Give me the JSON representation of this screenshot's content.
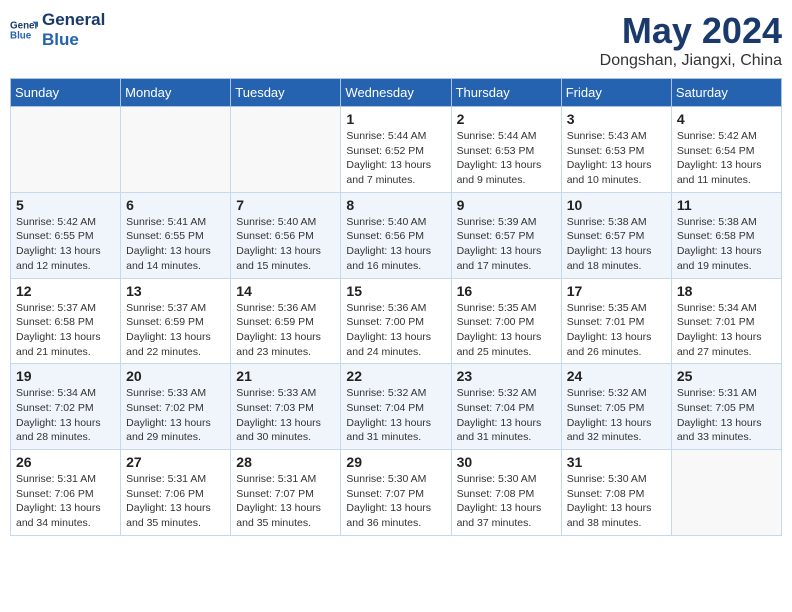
{
  "header": {
    "logo_line1": "General",
    "logo_line2": "Blue",
    "month_year": "May 2024",
    "location": "Dongshan, Jiangxi, China"
  },
  "weekdays": [
    "Sunday",
    "Monday",
    "Tuesday",
    "Wednesday",
    "Thursday",
    "Friday",
    "Saturday"
  ],
  "weeks": [
    [
      {
        "day": "",
        "info": ""
      },
      {
        "day": "",
        "info": ""
      },
      {
        "day": "",
        "info": ""
      },
      {
        "day": "1",
        "info": "Sunrise: 5:44 AM\nSunset: 6:52 PM\nDaylight: 13 hours\nand 7 minutes."
      },
      {
        "day": "2",
        "info": "Sunrise: 5:44 AM\nSunset: 6:53 PM\nDaylight: 13 hours\nand 9 minutes."
      },
      {
        "day": "3",
        "info": "Sunrise: 5:43 AM\nSunset: 6:53 PM\nDaylight: 13 hours\nand 10 minutes."
      },
      {
        "day": "4",
        "info": "Sunrise: 5:42 AM\nSunset: 6:54 PM\nDaylight: 13 hours\nand 11 minutes."
      }
    ],
    [
      {
        "day": "5",
        "info": "Sunrise: 5:42 AM\nSunset: 6:55 PM\nDaylight: 13 hours\nand 12 minutes."
      },
      {
        "day": "6",
        "info": "Sunrise: 5:41 AM\nSunset: 6:55 PM\nDaylight: 13 hours\nand 14 minutes."
      },
      {
        "day": "7",
        "info": "Sunrise: 5:40 AM\nSunset: 6:56 PM\nDaylight: 13 hours\nand 15 minutes."
      },
      {
        "day": "8",
        "info": "Sunrise: 5:40 AM\nSunset: 6:56 PM\nDaylight: 13 hours\nand 16 minutes."
      },
      {
        "day": "9",
        "info": "Sunrise: 5:39 AM\nSunset: 6:57 PM\nDaylight: 13 hours\nand 17 minutes."
      },
      {
        "day": "10",
        "info": "Sunrise: 5:38 AM\nSunset: 6:57 PM\nDaylight: 13 hours\nand 18 minutes."
      },
      {
        "day": "11",
        "info": "Sunrise: 5:38 AM\nSunset: 6:58 PM\nDaylight: 13 hours\nand 19 minutes."
      }
    ],
    [
      {
        "day": "12",
        "info": "Sunrise: 5:37 AM\nSunset: 6:58 PM\nDaylight: 13 hours\nand 21 minutes."
      },
      {
        "day": "13",
        "info": "Sunrise: 5:37 AM\nSunset: 6:59 PM\nDaylight: 13 hours\nand 22 minutes."
      },
      {
        "day": "14",
        "info": "Sunrise: 5:36 AM\nSunset: 6:59 PM\nDaylight: 13 hours\nand 23 minutes."
      },
      {
        "day": "15",
        "info": "Sunrise: 5:36 AM\nSunset: 7:00 PM\nDaylight: 13 hours\nand 24 minutes."
      },
      {
        "day": "16",
        "info": "Sunrise: 5:35 AM\nSunset: 7:00 PM\nDaylight: 13 hours\nand 25 minutes."
      },
      {
        "day": "17",
        "info": "Sunrise: 5:35 AM\nSunset: 7:01 PM\nDaylight: 13 hours\nand 26 minutes."
      },
      {
        "day": "18",
        "info": "Sunrise: 5:34 AM\nSunset: 7:01 PM\nDaylight: 13 hours\nand 27 minutes."
      }
    ],
    [
      {
        "day": "19",
        "info": "Sunrise: 5:34 AM\nSunset: 7:02 PM\nDaylight: 13 hours\nand 28 minutes."
      },
      {
        "day": "20",
        "info": "Sunrise: 5:33 AM\nSunset: 7:02 PM\nDaylight: 13 hours\nand 29 minutes."
      },
      {
        "day": "21",
        "info": "Sunrise: 5:33 AM\nSunset: 7:03 PM\nDaylight: 13 hours\nand 30 minutes."
      },
      {
        "day": "22",
        "info": "Sunrise: 5:32 AM\nSunset: 7:04 PM\nDaylight: 13 hours\nand 31 minutes."
      },
      {
        "day": "23",
        "info": "Sunrise: 5:32 AM\nSunset: 7:04 PM\nDaylight: 13 hours\nand 31 minutes."
      },
      {
        "day": "24",
        "info": "Sunrise: 5:32 AM\nSunset: 7:05 PM\nDaylight: 13 hours\nand 32 minutes."
      },
      {
        "day": "25",
        "info": "Sunrise: 5:31 AM\nSunset: 7:05 PM\nDaylight: 13 hours\nand 33 minutes."
      }
    ],
    [
      {
        "day": "26",
        "info": "Sunrise: 5:31 AM\nSunset: 7:06 PM\nDaylight: 13 hours\nand 34 minutes."
      },
      {
        "day": "27",
        "info": "Sunrise: 5:31 AM\nSunset: 7:06 PM\nDaylight: 13 hours\nand 35 minutes."
      },
      {
        "day": "28",
        "info": "Sunrise: 5:31 AM\nSunset: 7:07 PM\nDaylight: 13 hours\nand 35 minutes."
      },
      {
        "day": "29",
        "info": "Sunrise: 5:30 AM\nSunset: 7:07 PM\nDaylight: 13 hours\nand 36 minutes."
      },
      {
        "day": "30",
        "info": "Sunrise: 5:30 AM\nSunset: 7:08 PM\nDaylight: 13 hours\nand 37 minutes."
      },
      {
        "day": "31",
        "info": "Sunrise: 5:30 AM\nSunset: 7:08 PM\nDaylight: 13 hours\nand 38 minutes."
      },
      {
        "day": "",
        "info": ""
      }
    ]
  ]
}
